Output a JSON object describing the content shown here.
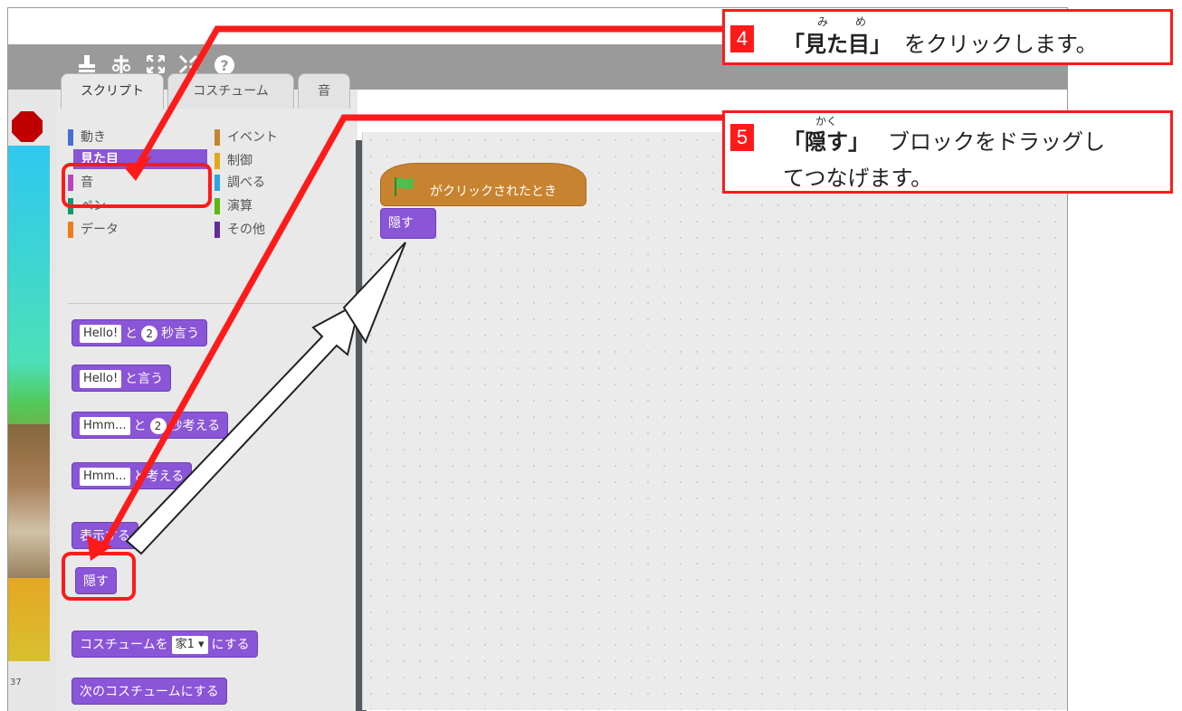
{
  "toolbar": {
    "icons": [
      "duplicate-stamp-icon",
      "delete-scissors-icon",
      "grow-icon",
      "shrink-icon",
      "help-icon"
    ],
    "help_glyph": "?"
  },
  "stage": {
    "counter_text": "37"
  },
  "tabs": [
    {
      "label": "スクリプト"
    },
    {
      "label": "コスチューム"
    },
    {
      "label": "音"
    }
  ],
  "categories": [
    {
      "label": "動き",
      "color": "#4a6cd4"
    },
    {
      "label": "見た目",
      "color": "#8a55d7"
    },
    {
      "label": "音",
      "color": "#bb42c3"
    },
    {
      "label": "ペン",
      "color": "#0e9a6c"
    },
    {
      "label": "データ",
      "color": "#ee7d16"
    },
    {
      "label": "イベント",
      "color": "#c88330"
    },
    {
      "label": "制御",
      "color": "#e1a91a"
    },
    {
      "label": "調べる",
      "color": "#2ca5e2"
    },
    {
      "label": "演算",
      "color": "#5cb712"
    },
    {
      "label": "その他",
      "color": "#632d99"
    }
  ],
  "palette_blocks": {
    "say_secs": {
      "field": "Hello!",
      "t1": "と",
      "num": "2",
      "t2": "秒言う"
    },
    "say": {
      "field": "Hello!",
      "t1": "と言う"
    },
    "think_secs": {
      "field": "Hmm...",
      "t1": "と",
      "num": "2",
      "t2": "秒考える"
    },
    "think": {
      "field": "Hmm...",
      "t1": "と考える"
    },
    "show": "表示する",
    "hide": "隠す",
    "switch_costume": {
      "t1": "コスチュームを",
      "field": "家1 ▾",
      "t2": "にする"
    },
    "next_costume": "次のコスチュームにする"
  },
  "script": {
    "hat_label": "がクリックされたとき",
    "hide_label": "隠す"
  },
  "callouts": {
    "step4": {
      "num": "4",
      "text_a": "「見た目」",
      "text_b": "をクリックします。",
      "ruby_a": "み",
      "ruby_b": "め"
    },
    "step5": {
      "num": "5",
      "text_a": "「隠す」",
      "text_b": "ブロックをドラッグし",
      "line2": "てつなげます。",
      "ruby": "かく"
    }
  },
  "colors": {
    "highlight": "#ff1a1a",
    "looks": "#8a55d7",
    "events": "#c88330"
  }
}
